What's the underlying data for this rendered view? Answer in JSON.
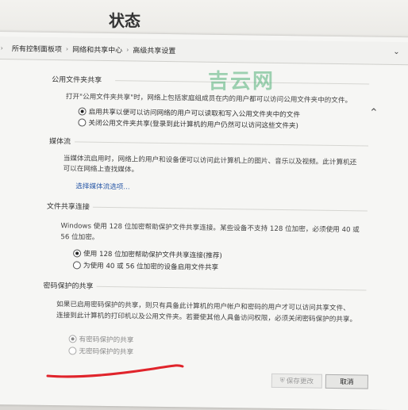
{
  "background": {
    "title": "状态"
  },
  "breadcrumb": {
    "items": [
      "所有控制面板项",
      "网络和共享中心",
      "高级共享设置"
    ]
  },
  "watermark": "吉云网",
  "public_folder": {
    "heading": "公用文件夹共享",
    "description": "打开\"公用文件夹共享\"时，网络上包括家庭组成员在内的用户都可以访问公用文件夹中的文件。",
    "options": [
      "启用共享以便可以访问网络的用户可以读取和写入公用文件夹中的文件",
      "关闭公用文件夹共享(登录到此计算机的用户仍然可以访问这些文件夹)"
    ]
  },
  "media_streaming": {
    "heading": "媒体流",
    "description_line1": "当媒体流启用时，网络上的用户和设备便可以访问此计算机上的图片、音乐以及视频。此计算机还",
    "description_line2": "可以在网络上查找媒体。",
    "link": "选择媒体流选项..."
  },
  "file_sharing": {
    "heading": "文件共享连接",
    "description_line1": "Windows 使用 128 位加密帮助保护文件共享连接。某些设备不支持 128 位加密，必须使用 40 或",
    "description_line2": "56 位加密。",
    "options": [
      "使用 128 位加密帮助保护文件共享连接(推荐)",
      "为使用 40 或 56 位加密的设备启用文件共享"
    ]
  },
  "password_sharing": {
    "heading": "密码保护的共享",
    "description_line1": "如果已启用密码保护的共享，则只有具备此计算机的用户帐户和密码的用户才可以访问共享文件、",
    "description_line2": "连接到此计算机的打印机以及公用文件夹。若要使其他人具备访问权限，必须关闭密码保护的共享。",
    "options": [
      "有密码保护的共享",
      "无密码保护的共享"
    ]
  },
  "buttons": {
    "save": "保存更改",
    "cancel": "取消"
  },
  "colors": {
    "link": "#2b5aa8",
    "annotation": "#e0242b",
    "watermark": "#52b078"
  }
}
